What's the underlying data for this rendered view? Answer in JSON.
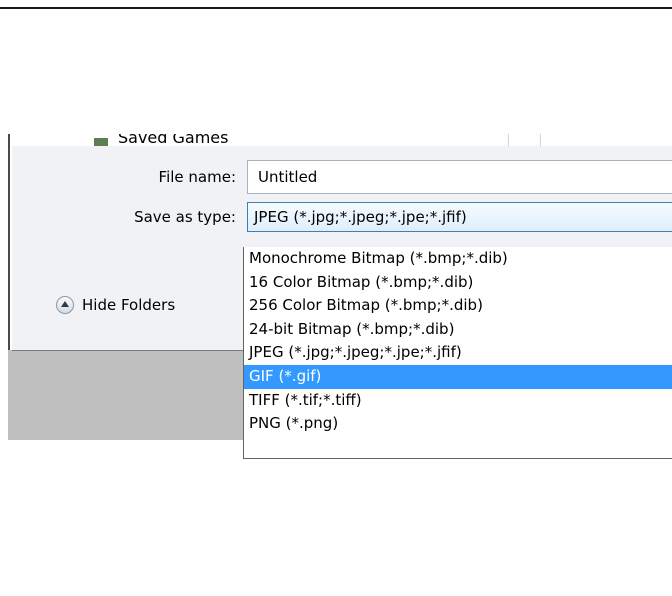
{
  "folder_tree": {
    "partial_item_label": "Saved Games"
  },
  "form": {
    "file_name_label": "File name:",
    "file_name_value": "Untitled",
    "save_as_type_label": "Save as type:",
    "save_as_type_value": "JPEG (*.jpg;*.jpeg;*.jpe;*.jfif)"
  },
  "hide_folders_label": "Hide Folders",
  "dropdown": {
    "items": [
      "Monochrome Bitmap (*.bmp;*.dib)",
      "16 Color Bitmap (*.bmp;*.dib)",
      "256 Color Bitmap (*.bmp;*.dib)",
      "24-bit Bitmap (*.bmp;*.dib)",
      "JPEG (*.jpg;*.jpeg;*.jpe;*.jfif)",
      "GIF (*.gif)",
      "TIFF (*.tif;*.tiff)",
      "PNG (*.png)"
    ],
    "highlighted": "GIF (*.gif)"
  },
  "colors": {
    "highlight": "#3399ff",
    "backdrop": "#bfbfbf"
  }
}
